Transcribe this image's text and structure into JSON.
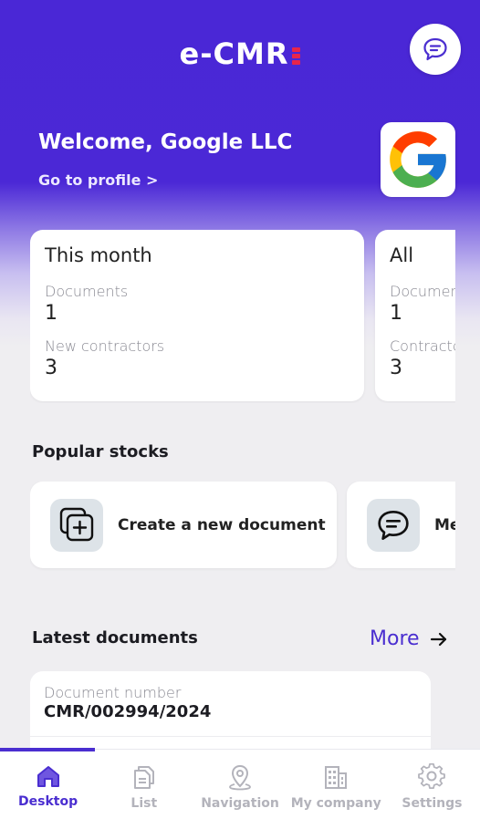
{
  "app": {
    "logo_text": "e-CMR",
    "brand_color": "#4a27d6",
    "accent_red": "#e8254a"
  },
  "header": {
    "chat_icon": "chat-bubble-icon"
  },
  "welcome": {
    "title": "Welcome, Google LLC",
    "profile_link": "Go to profile >",
    "avatar_icon": "google-logo"
  },
  "stats": [
    {
      "title": "This month",
      "label1": "Documents",
      "value1": "1",
      "label2": "New contractors",
      "value2": "3"
    },
    {
      "title": "All",
      "label1": "Documents",
      "value1": "1",
      "label2": "Contractors",
      "value2": "3"
    }
  ],
  "popular": {
    "title": "Popular stocks",
    "items": [
      {
        "label": "Create a new document",
        "icon": "add-document-icon"
      },
      {
        "label": "Me",
        "icon": "chat-bubble-icon"
      }
    ]
  },
  "latest": {
    "title": "Latest documents",
    "more": "More",
    "documents": [
      {
        "label": "Document number",
        "number": "CMR/002994/2024"
      }
    ]
  },
  "nav": [
    {
      "label": "Desktop",
      "icon": "home-icon",
      "active": true
    },
    {
      "label": "List",
      "icon": "documents-icon",
      "active": false
    },
    {
      "label": "Navigation",
      "icon": "location-pin-icon",
      "active": false
    },
    {
      "label": "My company",
      "icon": "building-icon",
      "active": false
    },
    {
      "label": "Settings",
      "icon": "gear-icon",
      "active": false
    }
  ]
}
